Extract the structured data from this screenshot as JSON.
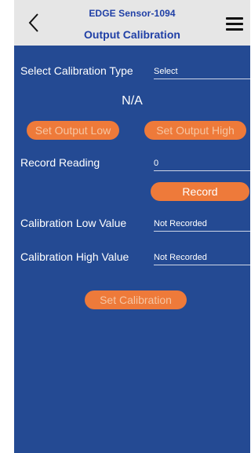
{
  "header": {
    "device_name": "EDGE Sensor-1094",
    "title": "Output Calibration",
    "back_icon": "chevron-left-icon",
    "menu_icon": "hamburger-menu-icon"
  },
  "form": {
    "calibration_type_label": "Select Calibration Type",
    "calibration_type_value": "Select",
    "status_text": "N/A",
    "set_output_low_label": "Set Output Low",
    "set_output_high_label": "Set Output High",
    "record_reading_label": "Record Reading",
    "record_reading_value": "0",
    "record_button_label": "Record",
    "calibration_low_label": "Calibration Low Value",
    "calibration_low_value": "Not Recorded",
    "calibration_high_label": "Calibration High Value",
    "calibration_high_value": "Not Recorded",
    "set_calibration_label": "Set Calibration"
  },
  "colors": {
    "header_bg": "#e6e6e6",
    "title_text": "#1f3fa6",
    "panel_bg": "#244a93",
    "button_bg": "#ee7a3a",
    "button_disabled_text": "#f6c6a3"
  }
}
